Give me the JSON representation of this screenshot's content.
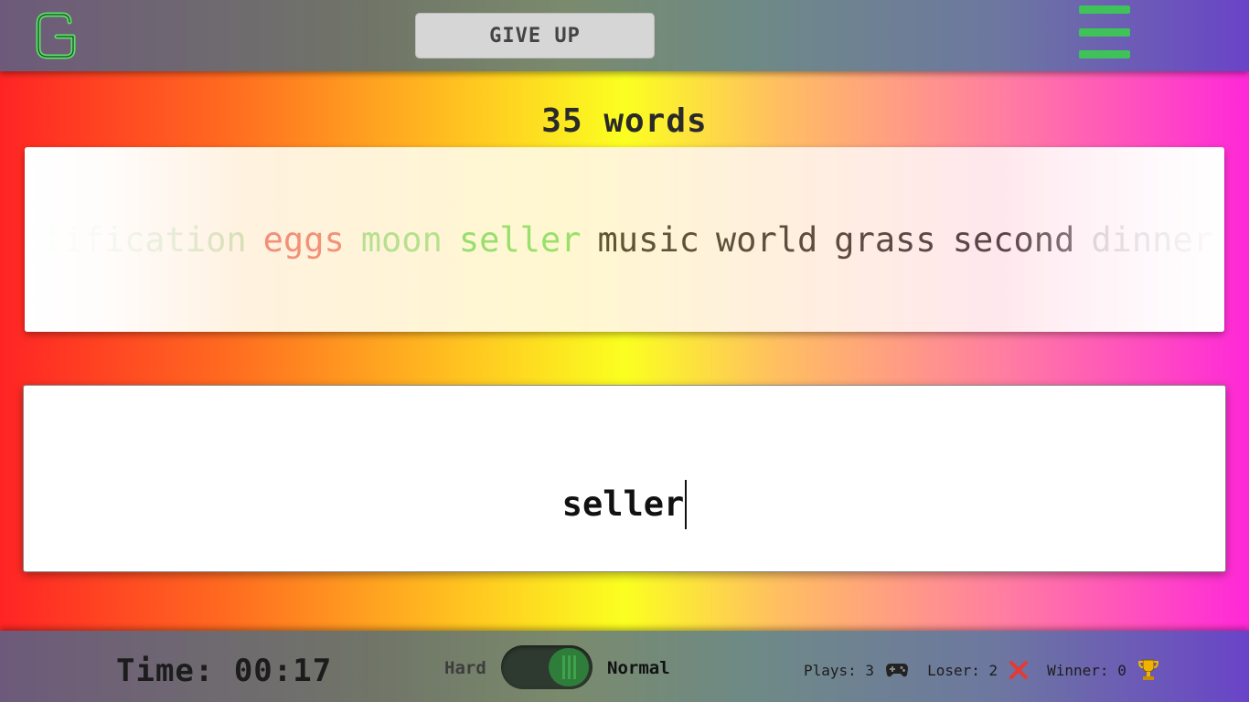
{
  "header": {
    "logo_letter": "G",
    "give_up_label": "GIVE UP",
    "menu_icon": "hamburger-menu-icon"
  },
  "game": {
    "word_count_label": "35 words",
    "words": [
      {
        "text": "notification",
        "state": "faded"
      },
      {
        "text": "eggs",
        "state": "wrong"
      },
      {
        "text": "moon",
        "state": "done"
      },
      {
        "text": "seller",
        "state": "current"
      },
      {
        "text": "music",
        "state": "pending"
      },
      {
        "text": "world",
        "state": "pending"
      },
      {
        "text": "grass",
        "state": "pending"
      },
      {
        "text": "second",
        "state": "pending"
      },
      {
        "text": "dinner",
        "state": "ghost"
      }
    ],
    "typed_text": "seller"
  },
  "footer": {
    "timer_label": "Time: 00:17",
    "mode_hard": "Hard",
    "mode_normal": "Normal",
    "mode_selected": "Normal",
    "plays_label": "Plays: 3",
    "loser_label": "Loser: 2",
    "winner_label": "Winner: 0",
    "icons": [
      "gamepad-icon",
      "cross-icon",
      "trophy-icon"
    ],
    "colors": {
      "accent_green": "#3fc25a",
      "cross_red": "#e53935",
      "trophy_gold": "#f0b400"
    }
  }
}
